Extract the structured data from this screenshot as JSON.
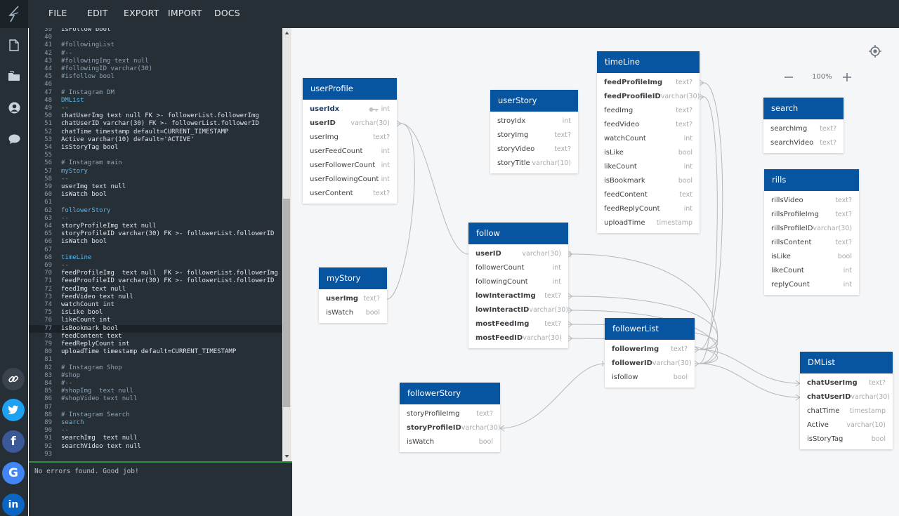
{
  "menu": [
    "FILE",
    "EDIT",
    "EXPORT",
    "IMPORT",
    "DOCS"
  ],
  "icons": {
    "logo": "bolt-logo-icon",
    "sidebar": [
      "file-icon",
      "folder-icon",
      "user-icon",
      "comment-icon"
    ],
    "social": [
      "link-icon",
      "twitter-icon",
      "facebook-icon",
      "google-icon",
      "linkedin-icon"
    ]
  },
  "colors": {
    "topbar": "#262e36",
    "table_header": "#0754a0",
    "console_accent": "#2d8f3f",
    "twitter": "#1da1f2",
    "facebook": "#3b5998",
    "google": "#4285f4",
    "linkedin": "#0a66c2"
  },
  "editor": {
    "lines": [
      {
        "n": "39",
        "text": "isFollow bool",
        "cls": "code"
      },
      {
        "n": "40",
        "text": "",
        "cls": "code"
      },
      {
        "n": "41",
        "text": "#followingList",
        "cls": "comment"
      },
      {
        "n": "42",
        "text": "#--",
        "cls": "comment"
      },
      {
        "n": "43",
        "text": "#followingImg text null",
        "cls": "comment"
      },
      {
        "n": "44",
        "text": "#followingID varchar(30)",
        "cls": "comment"
      },
      {
        "n": "45",
        "text": "#isfollow bool",
        "cls": "comment"
      },
      {
        "n": "46",
        "text": "",
        "cls": "code"
      },
      {
        "n": "47",
        "text": "# Instagram DM",
        "cls": "comment"
      },
      {
        "n": "48",
        "text": "DMList",
        "cls": "table"
      },
      {
        "n": "49",
        "text": "--",
        "cls": "comment"
      },
      {
        "n": "50",
        "text": "chatUserImg text null FK >- followerList.followerImg",
        "cls": "code"
      },
      {
        "n": "51",
        "text": "chatUserID varchar(30) FK >- followerList.followerID",
        "cls": "code"
      },
      {
        "n": "52",
        "text": "chatTime timestamp default=CURRENT_TIMESTAMP",
        "cls": "code"
      },
      {
        "n": "53",
        "text": "Active varchar(10) default='ACTIVE'",
        "cls": "code"
      },
      {
        "n": "54",
        "text": "isStoryTag bool",
        "cls": "code"
      },
      {
        "n": "55",
        "text": "",
        "cls": "code"
      },
      {
        "n": "56",
        "text": "# Instagram main",
        "cls": "comment"
      },
      {
        "n": "57",
        "text": "myStory",
        "cls": "table"
      },
      {
        "n": "58",
        "text": "--",
        "cls": "comment"
      },
      {
        "n": "59",
        "text": "userImg text null",
        "cls": "code"
      },
      {
        "n": "60",
        "text": "isWatch bool",
        "cls": "code"
      },
      {
        "n": "61",
        "text": "",
        "cls": "code"
      },
      {
        "n": "62",
        "text": "followerStory",
        "cls": "table"
      },
      {
        "n": "63",
        "text": "--",
        "cls": "comment"
      },
      {
        "n": "64",
        "text": "storyProfileImg text null",
        "cls": "code"
      },
      {
        "n": "65",
        "text": "storyProfileID varchar(30) FK >- followerList.followerID",
        "cls": "code"
      },
      {
        "n": "66",
        "text": "isWatch bool",
        "cls": "code"
      },
      {
        "n": "67",
        "text": "",
        "cls": "code"
      },
      {
        "n": "68",
        "text": "timeLine",
        "cls": "table"
      },
      {
        "n": "69",
        "text": "--",
        "cls": "comment"
      },
      {
        "n": "70",
        "text": "feedProfileImg  text null  FK >- followerList.followerImg",
        "cls": "code"
      },
      {
        "n": "71",
        "text": "feedProofileID varchar(30) FK >- followerList.followerID",
        "cls": "code"
      },
      {
        "n": "72",
        "text": "feedImg text null",
        "cls": "code"
      },
      {
        "n": "73",
        "text": "feedVideo text null",
        "cls": "code"
      },
      {
        "n": "74",
        "text": "watchCount int",
        "cls": "code"
      },
      {
        "n": "75",
        "text": "isLike bool",
        "cls": "code"
      },
      {
        "n": "76",
        "text": "likeCount int",
        "cls": "code"
      },
      {
        "n": "77",
        "text": "isBookmark bool",
        "cls": "code"
      },
      {
        "n": "78",
        "text": "feedContent text",
        "cls": "code"
      },
      {
        "n": "79",
        "text": "feedReplyCount int",
        "cls": "code"
      },
      {
        "n": "80",
        "text": "uploadTime timestamp default=CURRENT_TIMESTAMP",
        "cls": "code"
      },
      {
        "n": "81",
        "text": "",
        "cls": "code"
      },
      {
        "n": "82",
        "text": "# Instagram Shop",
        "cls": "comment"
      },
      {
        "n": "83",
        "text": "#shop",
        "cls": "comment"
      },
      {
        "n": "84",
        "text": "#--",
        "cls": "comment"
      },
      {
        "n": "85",
        "text": "#shopImg  text null",
        "cls": "comment"
      },
      {
        "n": "86",
        "text": "#shopVideo text null",
        "cls": "comment"
      },
      {
        "n": "87",
        "text": "",
        "cls": "code"
      },
      {
        "n": "88",
        "text": "# Instagram Search",
        "cls": "comment"
      },
      {
        "n": "89",
        "text": "search",
        "cls": "table"
      },
      {
        "n": "90",
        "text": "--",
        "cls": "comment"
      },
      {
        "n": "91",
        "text": "searchImg  text null",
        "cls": "code"
      },
      {
        "n": "92",
        "text": "searchVideo text null",
        "cls": "code"
      },
      {
        "n": "93",
        "text": "",
        "cls": "code"
      }
    ],
    "current_line": "77"
  },
  "console": {
    "message": "No errors found. Good job!"
  },
  "zoom": {
    "label": "100%",
    "minus": "—",
    "plus": "+"
  },
  "tables": [
    {
      "id": "userProfile",
      "title": "userProfile",
      "rows": [
        {
          "name": "userIdx",
          "type": "int",
          "kind": "pk"
        },
        {
          "name": "userID",
          "type": "varchar(30)",
          "kind": "fk"
        },
        {
          "name": "userImg",
          "type": "text?",
          "kind": ""
        },
        {
          "name": "userFeedCount",
          "type": "int",
          "kind": ""
        },
        {
          "name": "userFollowerCount",
          "type": "int",
          "kind": ""
        },
        {
          "name": "userFollowingCount",
          "type": "int",
          "kind": ""
        },
        {
          "name": "userContent",
          "type": "text?",
          "kind": ""
        }
      ]
    },
    {
      "id": "userStory",
      "title": "userStory",
      "rows": [
        {
          "name": "stroyIdx",
          "type": "int",
          "kind": ""
        },
        {
          "name": "storyImg",
          "type": "text?",
          "kind": ""
        },
        {
          "name": "storyVideo",
          "type": "text?",
          "kind": ""
        },
        {
          "name": "storyTitle",
          "type": "varchar(10)",
          "kind": ""
        }
      ]
    },
    {
      "id": "timeLine",
      "title": "timeLine",
      "rows": [
        {
          "name": "feedProfileImg",
          "type": "text?",
          "kind": "fk"
        },
        {
          "name": "feedProofileID",
          "type": "varchar(30)",
          "kind": "fk"
        },
        {
          "name": "feedImg",
          "type": "text?",
          "kind": ""
        },
        {
          "name": "feedVideo",
          "type": "text?",
          "kind": ""
        },
        {
          "name": "watchCount",
          "type": "int",
          "kind": ""
        },
        {
          "name": "isLike",
          "type": "bool",
          "kind": ""
        },
        {
          "name": "likeCount",
          "type": "int",
          "kind": ""
        },
        {
          "name": "isBookmark",
          "type": "bool",
          "kind": ""
        },
        {
          "name": "feedContent",
          "type": "text",
          "kind": ""
        },
        {
          "name": "feedReplyCount",
          "type": "int",
          "kind": ""
        },
        {
          "name": "uploadTime",
          "type": "timestamp",
          "kind": ""
        }
      ]
    },
    {
      "id": "search",
      "title": "search",
      "rows": [
        {
          "name": "searchImg",
          "type": "text?",
          "kind": ""
        },
        {
          "name": "searchVideo",
          "type": "text?",
          "kind": ""
        }
      ]
    },
    {
      "id": "rills",
      "title": "rills",
      "rows": [
        {
          "name": "rillsVideo",
          "type": "text?",
          "kind": ""
        },
        {
          "name": "rillsProfileImg",
          "type": "text?",
          "kind": ""
        },
        {
          "name": "rillsProfileID",
          "type": "varchar(30)",
          "kind": ""
        },
        {
          "name": "rillsContent",
          "type": "text?",
          "kind": ""
        },
        {
          "name": "isLike",
          "type": "bool",
          "kind": ""
        },
        {
          "name": "likeCount",
          "type": "int",
          "kind": ""
        },
        {
          "name": "replyCount",
          "type": "int",
          "kind": ""
        }
      ]
    },
    {
      "id": "follow",
      "title": "follow",
      "rows": [
        {
          "name": "userID",
          "type": "varchar(30)",
          "kind": "fk"
        },
        {
          "name": "followerCount",
          "type": "int",
          "kind": ""
        },
        {
          "name": "followingCount",
          "type": "int",
          "kind": ""
        },
        {
          "name": "lowInteractImg",
          "type": "text?",
          "kind": "fk"
        },
        {
          "name": "lowInteractID",
          "type": "varchar(30)",
          "kind": "fk"
        },
        {
          "name": "mostFeedImg",
          "type": "text?",
          "kind": "fk"
        },
        {
          "name": "mostFeedID",
          "type": "varchar(30)",
          "kind": "fk"
        }
      ]
    },
    {
      "id": "myStory",
      "title": "myStory",
      "rows": [
        {
          "name": "userImg",
          "type": "text?",
          "kind": "fk"
        },
        {
          "name": "isWatch",
          "type": "bool",
          "kind": ""
        }
      ]
    },
    {
      "id": "followerList",
      "title": "followerList",
      "rows": [
        {
          "name": "followerImg",
          "type": "text?",
          "kind": "fk"
        },
        {
          "name": "followerID",
          "type": "varchar(30)",
          "kind": "fk"
        },
        {
          "name": "isfollow",
          "type": "bool",
          "kind": ""
        }
      ]
    },
    {
      "id": "followerStory",
      "title": "followerStory",
      "rows": [
        {
          "name": "storyProfileImg",
          "type": "text?",
          "kind": ""
        },
        {
          "name": "storyProfileID",
          "type": "varchar(30)",
          "kind": "fk"
        },
        {
          "name": "isWatch",
          "type": "bool",
          "kind": ""
        }
      ]
    },
    {
      "id": "DMList",
      "title": "DMList",
      "rows": [
        {
          "name": "chatUserImg",
          "type": "text?",
          "kind": "fk"
        },
        {
          "name": "chatUserID",
          "type": "varchar(30)",
          "kind": "fk"
        },
        {
          "name": "chatTime",
          "type": "timestamp",
          "kind": ""
        },
        {
          "name": "Active",
          "type": "varchar(10)",
          "kind": ""
        },
        {
          "name": "isStoryTag",
          "type": "bool",
          "kind": ""
        }
      ]
    }
  ],
  "relations": [
    {
      "from": "userProfile.userID",
      "to": "follow.userID"
    },
    {
      "from": "userProfile.userID",
      "to": "myStory.userImg"
    },
    {
      "from": "follow.userID",
      "to": "followerList.followerID"
    },
    {
      "from": "follow.lowInteractImg",
      "to": "followerList.followerImg"
    },
    {
      "from": "follow.lowInteractID",
      "to": "followerList.followerID"
    },
    {
      "from": "follow.mostFeedImg",
      "to": "followerList.followerImg"
    },
    {
      "from": "follow.mostFeedID",
      "to": "followerList.followerID"
    },
    {
      "from": "timeLine.feedProfileImg",
      "to": "followerList.followerImg"
    },
    {
      "from": "timeLine.feedProofileID",
      "to": "followerList.followerID"
    },
    {
      "from": "followerStory.storyProfileID",
      "to": "followerList.followerID"
    },
    {
      "from": "DMList.chatUserImg",
      "to": "followerList.followerImg"
    },
    {
      "from": "DMList.chatUserID",
      "to": "followerList.followerID"
    }
  ]
}
